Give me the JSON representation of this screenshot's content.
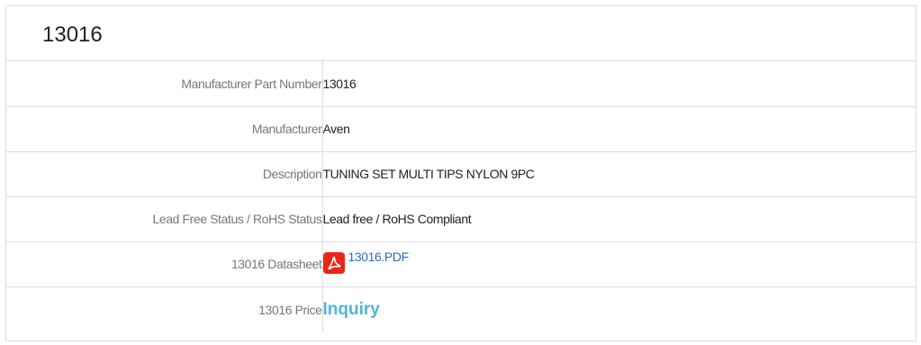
{
  "header": {
    "title": "13016"
  },
  "rows": [
    {
      "label": "Manufacturer Part Number",
      "value": "13016"
    },
    {
      "label": "Manufacturer",
      "value": "Aven"
    },
    {
      "label": "Description",
      "value": "TUNING SET MULTI TIPS NYLON 9PC"
    },
    {
      "label": "Lead Free Status / RoHS Status",
      "value": "Lead free / RoHS Compliant"
    },
    {
      "label": "13016 Datasheet",
      "value": "13016.PDF",
      "icon": "pdf-icon"
    },
    {
      "label": "13016 Price",
      "value": "Inquiry"
    }
  ],
  "colors": {
    "border": "#dddddd",
    "label_text": "#777777",
    "value_text": "#222222",
    "link": "#2a6ebb",
    "inquiry": "#4fb6dc",
    "pdf_icon": "#e8271a"
  }
}
